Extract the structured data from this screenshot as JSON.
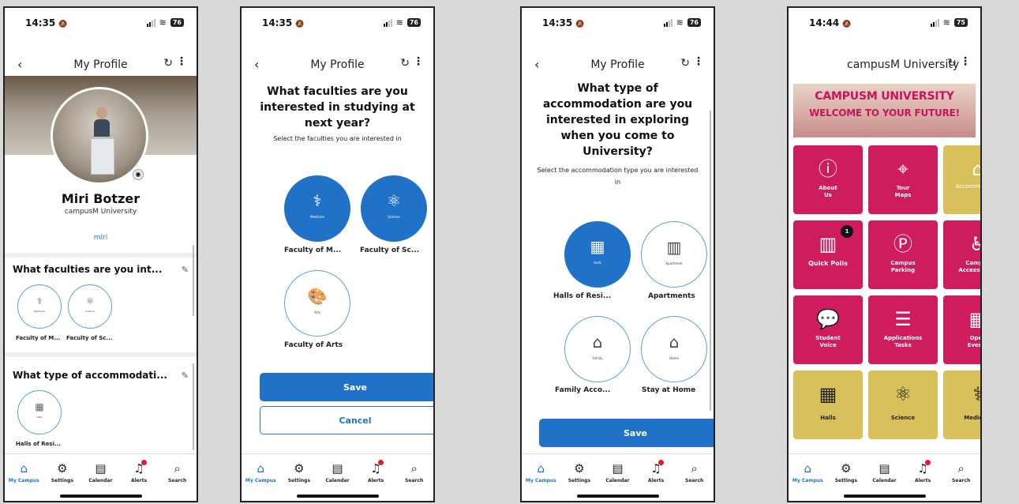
{
  "status": {
    "time1": "14:35",
    "time2": "14:35",
    "time3": "14:35",
    "time4": "14:44",
    "battery1": "76",
    "battery2": "76",
    "battery3": "76",
    "battery4": "75"
  },
  "tabs": [
    {
      "label": "My Campus",
      "icon": "home-icon"
    },
    {
      "label": "Settings",
      "icon": "gear-icon"
    },
    {
      "label": "Calendar",
      "icon": "calendar-icon"
    },
    {
      "label": "Alerts",
      "icon": "bell-icon"
    },
    {
      "label": "Search",
      "icon": "search-icon"
    }
  ],
  "screen1": {
    "title": "My Profile",
    "name": "Miri Botzer",
    "org": "campusM University",
    "username": "miri",
    "section1": {
      "title": "What faculties are you int...",
      "items": [
        {
          "icon_label": "Medicine",
          "label": "Faculty of M..."
        },
        {
          "icon_label": "Science",
          "label": "Faculty of Sc..."
        }
      ]
    },
    "section2": {
      "title": "What type of accommodati...",
      "items": [
        {
          "icon_label": "Halls",
          "label": "Halls of Resi..."
        }
      ]
    }
  },
  "screen2": {
    "title": "My Profile",
    "question": "What faculties are you interested in studying at next year?",
    "subtitle": "Select the faculties you are interested in",
    "options": [
      {
        "icon_label": "Medicine",
        "label": "Faculty of M...",
        "selected": true
      },
      {
        "icon_label": "Science",
        "label": "Faculty of Sc...",
        "selected": true
      },
      {
        "icon_label": "Arts",
        "label": "Faculty of Arts",
        "selected": false
      }
    ],
    "save": "Save",
    "cancel": "Cancel"
  },
  "screen3": {
    "title": "My Profile",
    "question": "What type of accommodation are you interested in exploring when you come to University?",
    "subtitle": "Select the accommodation type you are interested in",
    "options": [
      {
        "icon_label": "Halls",
        "label": "Halls of Resi...",
        "selected": true
      },
      {
        "icon_label": "Apartment",
        "label": "Apartments",
        "selected": false
      },
      {
        "icon_label": "Family",
        "label": "Family Acco...",
        "selected": false
      },
      {
        "icon_label": "Home",
        "label": "Stay at Home",
        "selected": false
      }
    ],
    "save": "Save"
  },
  "screen4": {
    "title": "campusM University",
    "banner_line1": "CAMPUSM UNIVERSITY",
    "banner_line2": "WELCOME TO YOUR FUTURE!",
    "tiles": [
      {
        "label": "About\nUs",
        "icon": "info-icon",
        "color": "pink"
      },
      {
        "label": "Tour\nMaps",
        "icon": "route-icon",
        "color": "pink"
      },
      {
        "label": "Accommodation",
        "icon": "house-icon",
        "color": "gold"
      },
      {
        "label": "Quick Polls",
        "icon": "chart-icon",
        "color": "pink",
        "badge": "1"
      },
      {
        "label": "Campus\nParking",
        "icon": "parking-icon",
        "color": "pink"
      },
      {
        "label": "Campus\nAccessibility",
        "icon": "accessibility-icon",
        "color": "pink"
      },
      {
        "label": "Student\nVoice",
        "icon": "speech-bubble-icon",
        "color": "pink"
      },
      {
        "label": "Applications\nTasks",
        "icon": "clipboard-icon",
        "color": "pink"
      },
      {
        "label": "Open\nEvents",
        "icon": "events-icon",
        "color": "pink"
      },
      {
        "label": "Halls",
        "icon": "building-icon",
        "color": "gold"
      },
      {
        "label": "Science",
        "icon": "atom-icon",
        "color": "gold"
      },
      {
        "label": "Medicine",
        "icon": "caduceus-icon",
        "color": "gold"
      }
    ]
  }
}
